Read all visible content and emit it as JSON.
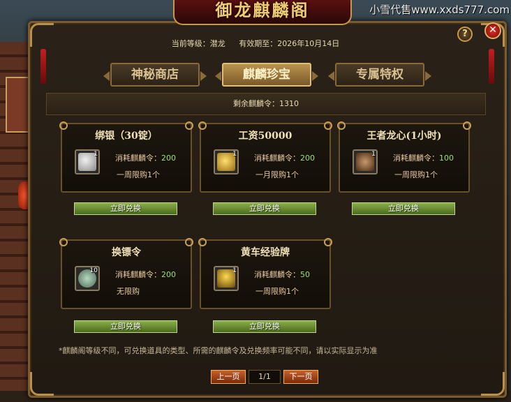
{
  "banner": {
    "title": "御龙麒麟阁"
  },
  "watermark": "小雪代售www.xxds777.com",
  "header": {
    "level_label": "当前等级：潜龙",
    "expiry_label": "有效期至：2026年10月14日"
  },
  "tabs": [
    {
      "label": "神秘商店",
      "active": false
    },
    {
      "label": "麒麟珍宝",
      "active": true
    },
    {
      "label": "专属特权",
      "active": false
    }
  ],
  "remaining": "剩余麒麟令：1310",
  "cost_label": "消耗麒麟令：",
  "redeem_label": "立即兑换",
  "items": [
    {
      "name": "绑银（30锭）",
      "qty": "1",
      "cost": "200",
      "limit": "一周限购1个",
      "icon": "silver-ingot-icon"
    },
    {
      "name": "工资50000",
      "qty": "1",
      "cost": "200",
      "limit": "一月限购1个",
      "icon": "gold-coins-icon"
    },
    {
      "name": "王者龙心(1小时)",
      "qty": "1",
      "cost": "100",
      "limit": "一周限购1个",
      "icon": "dragon-heart-icon"
    },
    {
      "name": "换镖令",
      "qty": "10",
      "cost": "200",
      "limit": "无限购",
      "icon": "escort-token-icon"
    },
    {
      "name": "黄车经验牌",
      "qty": "1",
      "cost": "50",
      "limit": "一周限购1个",
      "icon": "golden-cart-icon"
    }
  ],
  "footnote": "*麒麟阁等级不同，可兑换道具的类型、所需的麒麟令及兑换频率可能不同，请以实际显示为准",
  "pager": {
    "prev": "上一页",
    "page": "1/1",
    "next": "下一页"
  },
  "buttons": {
    "help": "?",
    "close": "✕"
  },
  "colors": {
    "accent_gold": "#c89a48",
    "redeem_green": "#6a8a2c",
    "cost_green": "#9ae07a"
  }
}
